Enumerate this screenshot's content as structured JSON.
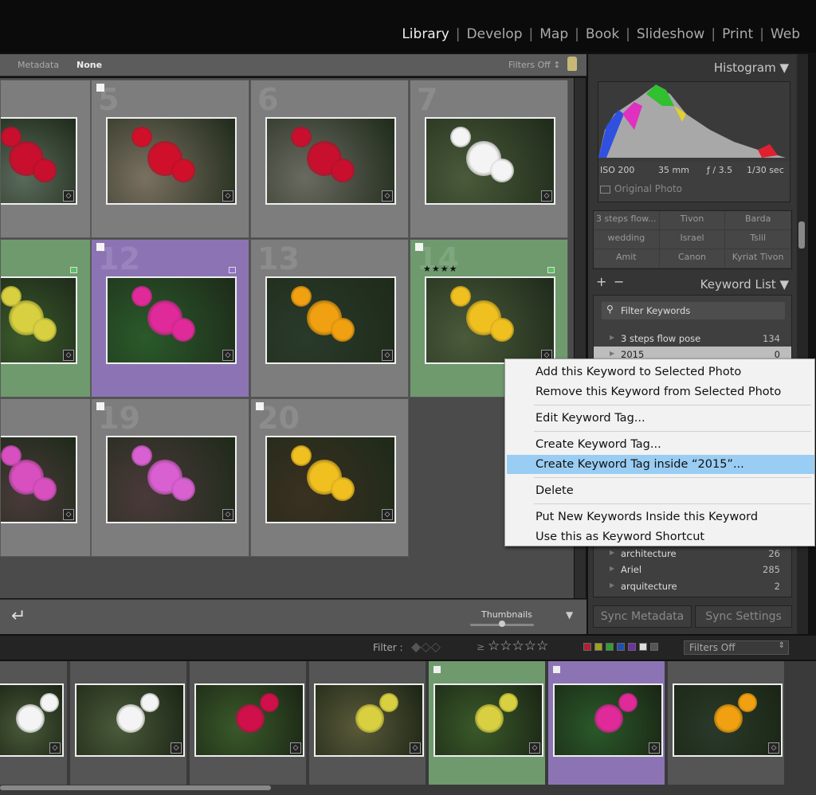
{
  "modules": [
    {
      "label": "Library",
      "active": true
    },
    {
      "label": "Develop"
    },
    {
      "label": "Map"
    },
    {
      "label": "Book"
    },
    {
      "label": "Slideshow"
    },
    {
      "label": "Print"
    },
    {
      "label": "Web"
    }
  ],
  "filter_bar": {
    "metadata": "Metadata",
    "none": "None",
    "filters": "Filters Off ↕"
  },
  "grid": {
    "cells": [
      {
        "num": "",
        "bg": "#7d7d7d",
        "flag": false,
        "flower": "#c8102e",
        "bgthumb": "#5a6a5a"
      },
      {
        "num": "5",
        "bg": "#7d7d7d",
        "flag": true,
        "flower": "#d0102a",
        "bgthumb": "#7a7060"
      },
      {
        "num": "6",
        "bg": "#7d7d7d",
        "flag": false,
        "flower": "#c8102e",
        "bgthumb": "#6a6a60"
      },
      {
        "num": "7",
        "bg": "#7d7d7d",
        "flag": false,
        "flower": "#f4f4f4",
        "bgthumb": "#4a5a3a"
      },
      {
        "num": "",
        "bg": "#6e9a6e",
        "flag": false,
        "flower": "#d8d040",
        "bgthumb": "#3a5a2a",
        "label": "#5fbf5f"
      },
      {
        "num": "12",
        "bg": "#8c74b4",
        "flag": true,
        "flower": "#e02a9a",
        "bgthumb": "#2a5a2a",
        "label": "#8f6fd0"
      },
      {
        "num": "13",
        "bg": "#7d7d7d",
        "flag": false,
        "flower": "#f0a010",
        "bgthumb": "#2a3a2a"
      },
      {
        "num": "14",
        "bg": "#6e9a6e",
        "flag": true,
        "flower": "#f0c020",
        "bgthumb": "#4a5a3a",
        "stars": "★★★★",
        "label": "#5fbf5f"
      },
      {
        "num": "",
        "bg": "#7d7d7d",
        "flag": false,
        "flower": "#d850c0",
        "bgthumb": "#4a3a3a"
      },
      {
        "num": "19",
        "bg": "#7d7d7d",
        "flag": true,
        "flower": "#d860d0",
        "bgthumb": "#4a3a3a"
      },
      {
        "num": "20",
        "bg": "#7d7d7d",
        "flag": true,
        "flower": "#f0c020",
        "bgthumb": "#3a3020"
      }
    ]
  },
  "toolbar": {
    "thumbnails": "Thumbnails",
    "slider_level": 0.5
  },
  "histogram": {
    "title": "Histogram",
    "iso": "ISO 200",
    "focal": "35 mm",
    "aperture": "ƒ / 3.5",
    "shutter": "1/30 sec",
    "original_photo": "Original Photo"
  },
  "keyword_set": [
    "3 steps flow...",
    "Tivon",
    "Barda",
    "wedding",
    "Israel",
    "Tslil",
    "Amit",
    "Canon",
    "Kyriat Tivon"
  ],
  "keyword_list": {
    "title": "Keyword List",
    "filter_placeholder": "Filter Keywords",
    "items": [
      {
        "name": "3 steps flow pose",
        "count": "134"
      },
      {
        "name": "2015",
        "count": "0",
        "selected": true
      },
      {
        "name": "architecture",
        "count": "26"
      },
      {
        "name": "Ariel",
        "count": "285"
      },
      {
        "name": "arquitecture",
        "count": "2"
      }
    ]
  },
  "sync": {
    "metadata": "Sync Metadata",
    "settings": "Sync Settings"
  },
  "filmstrip_bar": {
    "filter": "Filter :",
    "gte": "≥",
    "stars": "☆☆☆☆☆",
    "filters": "Filters Off",
    "label_colors": [
      "#b02030",
      "#a0a020",
      "#30a030",
      "#2050b0",
      "#7030a0",
      "#dddddd",
      "#555555"
    ]
  },
  "filmstrip": [
    {
      "flower": "#f4f4f4",
      "bg": "#4a5a3a",
      "cell": "#555"
    },
    {
      "flower": "#f4f4f4",
      "bg": "#4a5a3a",
      "cell": "#555"
    },
    {
      "flower": "#d0104a",
      "bg": "#3a5a2a",
      "cell": "#555"
    },
    {
      "flower": "#d8d040",
      "bg": "#5a5a3a",
      "cell": "#555"
    },
    {
      "flower": "#d8d040",
      "bg": "#3a5a2a",
      "cell": "#6e9a6e",
      "flag": true
    },
    {
      "flower": "#e02a9a",
      "bg": "#2a5a2a",
      "cell": "#8c74b4",
      "flag": true
    },
    {
      "flower": "#f0a010",
      "bg": "#2a3a2a",
      "cell": "#555"
    }
  ],
  "context_menu": [
    {
      "label": "Add this Keyword to Selected Photo"
    },
    {
      "label": "Remove this Keyword from Selected Photo"
    },
    {
      "sep": true
    },
    {
      "label": "Edit Keyword Tag..."
    },
    {
      "sep": true
    },
    {
      "label": "Create Keyword Tag..."
    },
    {
      "label": "Create Keyword Tag inside “2015”...",
      "highlighted": true
    },
    {
      "sep": true
    },
    {
      "label": "Delete"
    },
    {
      "sep": true
    },
    {
      "label": "Put New Keywords Inside this Keyword"
    },
    {
      "label": "Use this as Keyword Shortcut"
    }
  ]
}
